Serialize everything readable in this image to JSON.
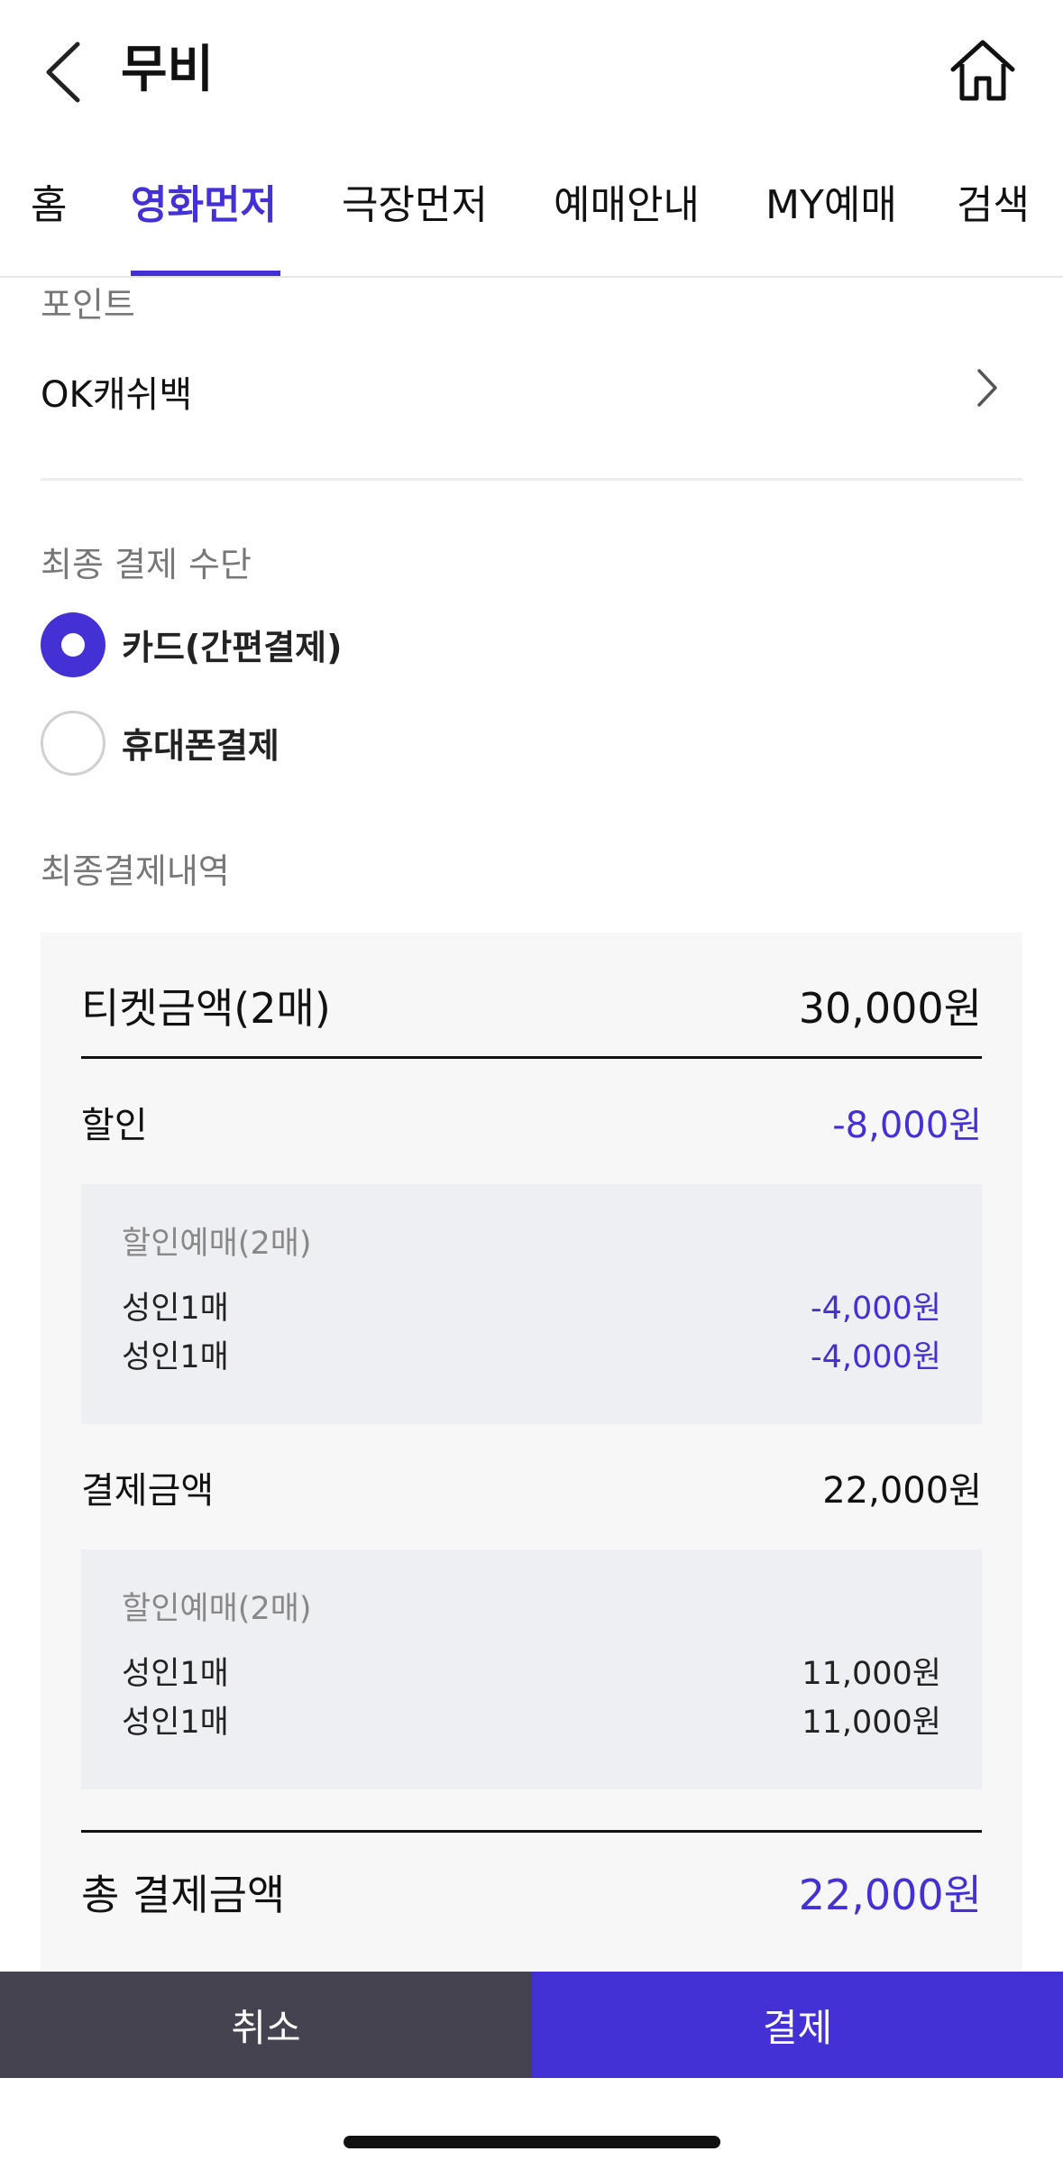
{
  "header": {
    "title": "무비",
    "back_icon": "chevron-left-icon",
    "home_icon": "home-icon"
  },
  "tabs": [
    {
      "label": "홈",
      "active": false
    },
    {
      "label": "영화먼저",
      "active": true
    },
    {
      "label": "극장먼저",
      "active": false
    },
    {
      "label": "예매안내",
      "active": false
    },
    {
      "label": "MY예매",
      "active": false
    },
    {
      "label": "검색",
      "active": false
    }
  ],
  "point": {
    "section_label": "포인트",
    "item_label": "OK캐쉬백"
  },
  "payment_method": {
    "section_label": "최종 결제 수단",
    "options": [
      {
        "label": "카드(간편결제)",
        "selected": true
      },
      {
        "label": "휴대폰결제",
        "selected": false
      }
    ]
  },
  "summary": {
    "section_label": "최종결제내역",
    "ticket_label": "티켓금액(2매)",
    "ticket_amount": "30,000원",
    "discount_label": "할인",
    "discount_amount": "-8,000원",
    "discount_detail": {
      "heading": "할인예매(2매)",
      "rows": [
        {
          "label": "성인1매",
          "value": "-4,000원"
        },
        {
          "label": "성인1매",
          "value": "-4,000원"
        }
      ]
    },
    "pay_label": "결제금액",
    "pay_amount": "22,000원",
    "pay_detail": {
      "heading": "할인예매(2매)",
      "rows": [
        {
          "label": "성인1매",
          "value": "11,000원"
        },
        {
          "label": "성인1매",
          "value": "11,000원"
        }
      ]
    },
    "total_label": "총 결제금액",
    "total_amount": "22,000원"
  },
  "actions": {
    "cancel_label": "취소",
    "pay_label": "결제"
  },
  "colors": {
    "accent": "#4431d6",
    "cancel_bg": "#45434f"
  }
}
